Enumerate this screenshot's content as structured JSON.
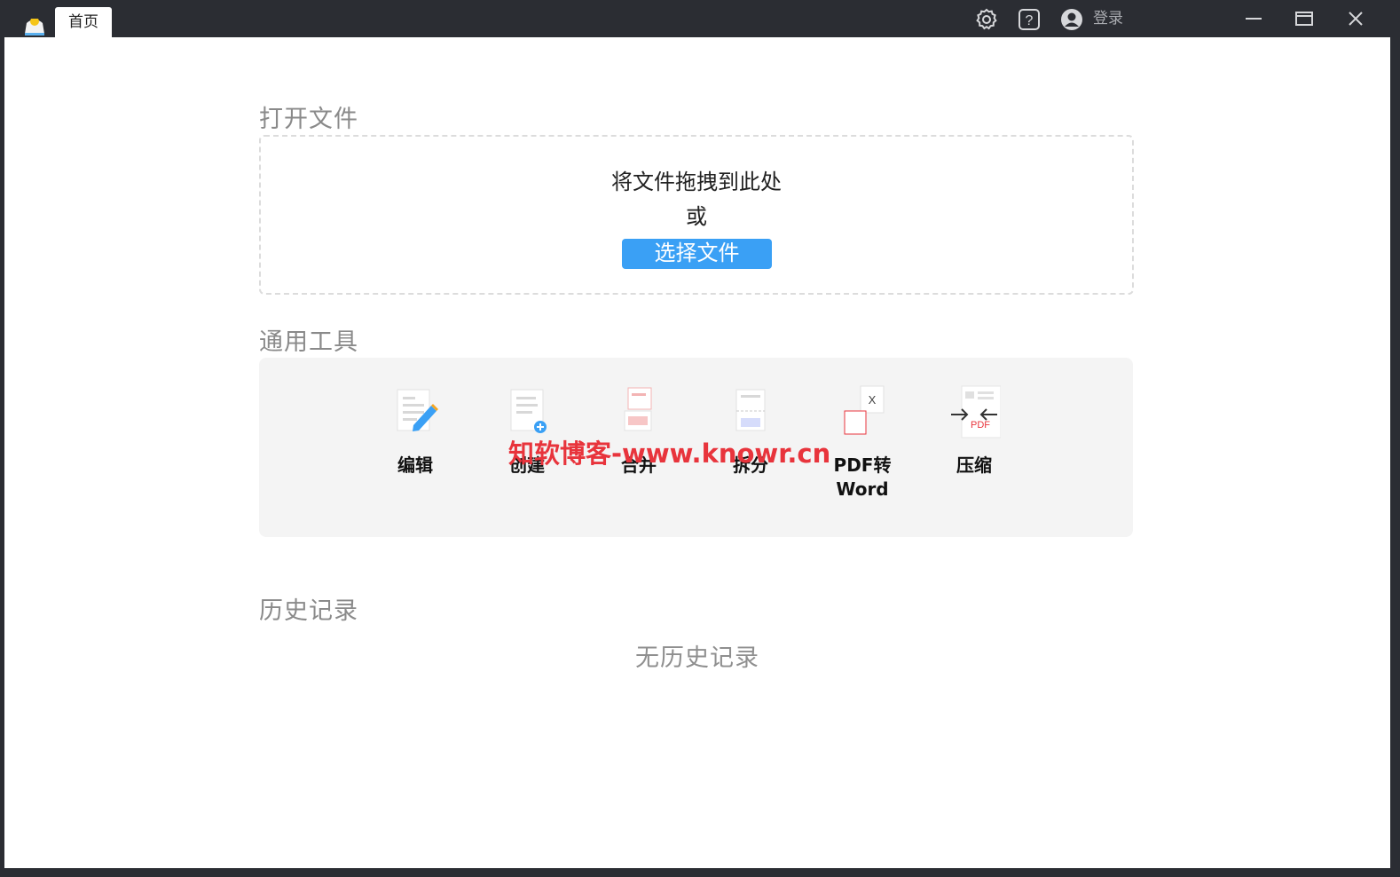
{
  "titlebar": {
    "app_icon": "app-logo-icon",
    "tab_label": "首页",
    "settings_icon": "gear-icon",
    "help_icon": "help-icon",
    "user_icon": "user-avatar-icon",
    "login_label": "登录",
    "minimize_icon": "minimize-icon",
    "maximize_icon": "maximize-icon",
    "close_icon": "close-icon"
  },
  "open_file": {
    "title": "打开文件",
    "drop_text": "将文件拖拽到此处",
    "or_text": "或",
    "choose_button": "选择文件"
  },
  "tools": {
    "title": "通用工具",
    "items": [
      {
        "label": "编辑",
        "icon": "edit-icon"
      },
      {
        "label": "创建",
        "icon": "create-icon"
      },
      {
        "label": "合并",
        "icon": "merge-icon"
      },
      {
        "label": "拆分",
        "icon": "split-icon"
      },
      {
        "label": "PDF转",
        "label2": "Word",
        "icon": "pdf-to-word-icon"
      },
      {
        "label": "压缩",
        "icon": "compress-icon"
      }
    ]
  },
  "history": {
    "title": "历史记录",
    "empty_text": "无历史记录"
  },
  "watermark": "知软博客-www.knowr.cn",
  "colors": {
    "titlebar_bg": "#2b2d33",
    "accent_blue": "#3aa0f5",
    "watermark_red": "#e8343c"
  }
}
